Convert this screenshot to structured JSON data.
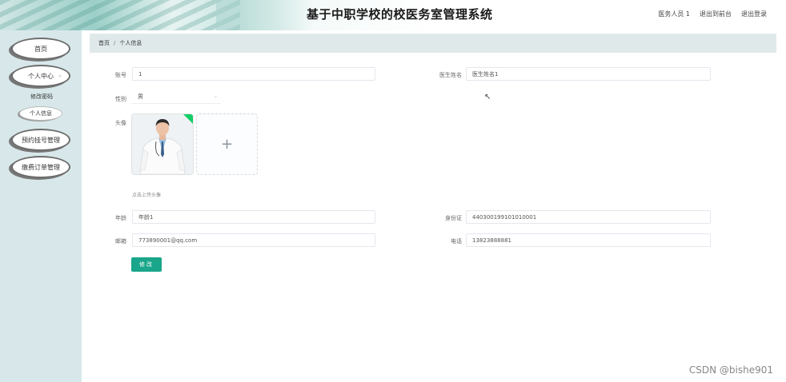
{
  "header": {
    "title": "基于中职学校的校医务室管理系统",
    "user_label": "医务人员 1",
    "front_link": "退出到前台",
    "logout_link": "退出登录"
  },
  "sidebar": {
    "items": [
      {
        "label": "首页"
      },
      {
        "label": "个人中心"
      },
      {
        "label": "修改密码"
      },
      {
        "label": "个人信息"
      },
      {
        "label": "预约挂号管理"
      },
      {
        "label": "缴费订单管理"
      }
    ]
  },
  "breadcrumb": {
    "home": "首页",
    "separator": "/",
    "current": "个人信息"
  },
  "form": {
    "account": {
      "label": "账号",
      "value": "1"
    },
    "doctor_name": {
      "label": "医生姓名",
      "value": "医生姓名1"
    },
    "gender": {
      "label": "性别",
      "value": "男"
    },
    "avatar": {
      "label": "头像",
      "hint": "点击上传头像"
    },
    "age": {
      "label": "年龄",
      "value": "年龄1"
    },
    "id_card": {
      "label": "身份证",
      "value": "440300199101010001"
    },
    "email": {
      "label": "邮箱",
      "value": "773890001@qq.com"
    },
    "phone": {
      "label": "电话",
      "value": "13823888881"
    },
    "submit": "修改"
  },
  "watermark": "CSDN @bishe901",
  "colors": {
    "primary_button": "#1aa68a",
    "sidebar_bg": "#d8e8ea",
    "breadcrumb_bg": "#dfe9ea"
  }
}
